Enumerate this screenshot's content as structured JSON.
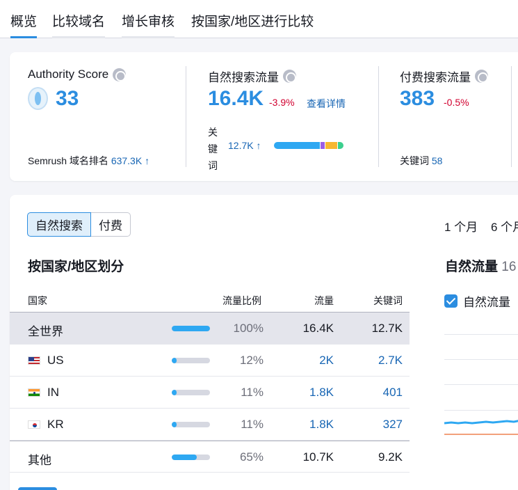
{
  "tabs": [
    "概览",
    "比较域名",
    "增长审核",
    "按国家/地区进行比较"
  ],
  "summary": {
    "authority": {
      "label": "Authority Score",
      "value": "33",
      "rank_label": "Semrush 域名排名",
      "rank_value": "637.3K ↑"
    },
    "organic": {
      "label": "自然搜索流量",
      "value": "16.4K",
      "delta": "-3.9%",
      "link": "查看详情",
      "kw_label": "关键词",
      "kw_value": "12.7K ↑"
    },
    "paid": {
      "label": "付费搜索流量",
      "value": "383",
      "delta": "-0.5%",
      "kw_label": "关键词",
      "kw_value": "58"
    }
  },
  "keyword_distribution": [
    {
      "color": "#2ea8f2",
      "share": 0.68
    },
    {
      "color": "#9b5de5",
      "share": 0.06
    },
    {
      "color": "#f7b731",
      "share": 0.18
    },
    {
      "color": "#3ccf8e",
      "share": 0.08
    }
  ],
  "toggle": {
    "organic": "自然搜索",
    "paid": "付费"
  },
  "periods": [
    "1 个月",
    "6 个月"
  ],
  "country_section": {
    "title": "按国家/地区划分",
    "columns": {
      "country": "国家",
      "share": "流量比例",
      "traffic": "流量",
      "keywords": "关键词"
    },
    "rows": [
      {
        "name": "全世界",
        "flag": "",
        "share": 1.0,
        "share_text": "100%",
        "traffic": "16.4K",
        "keywords": "12.7K",
        "linked": false
      },
      {
        "name": "US",
        "flag": "us",
        "share": 0.12,
        "share_text": "12%",
        "traffic": "2K",
        "keywords": "2.7K",
        "linked": true
      },
      {
        "name": "IN",
        "flag": "in",
        "share": 0.11,
        "share_text": "11%",
        "traffic": "1.8K",
        "keywords": "401",
        "linked": true
      },
      {
        "name": "KR",
        "flag": "kr",
        "share": 0.11,
        "share_text": "11%",
        "traffic": "1.8K",
        "keywords": "327",
        "linked": true
      },
      {
        "name": "其他",
        "flag": "",
        "share": 0.65,
        "share_text": "65%",
        "traffic": "10.7K",
        "keywords": "9.2K",
        "linked": false
      }
    ]
  },
  "chart": {
    "title": "自然流量",
    "title_cut": "16",
    "legend": "自然流量",
    "colors": {
      "organic": "#2ea8f2",
      "paid": "#f2a07b"
    }
  }
}
